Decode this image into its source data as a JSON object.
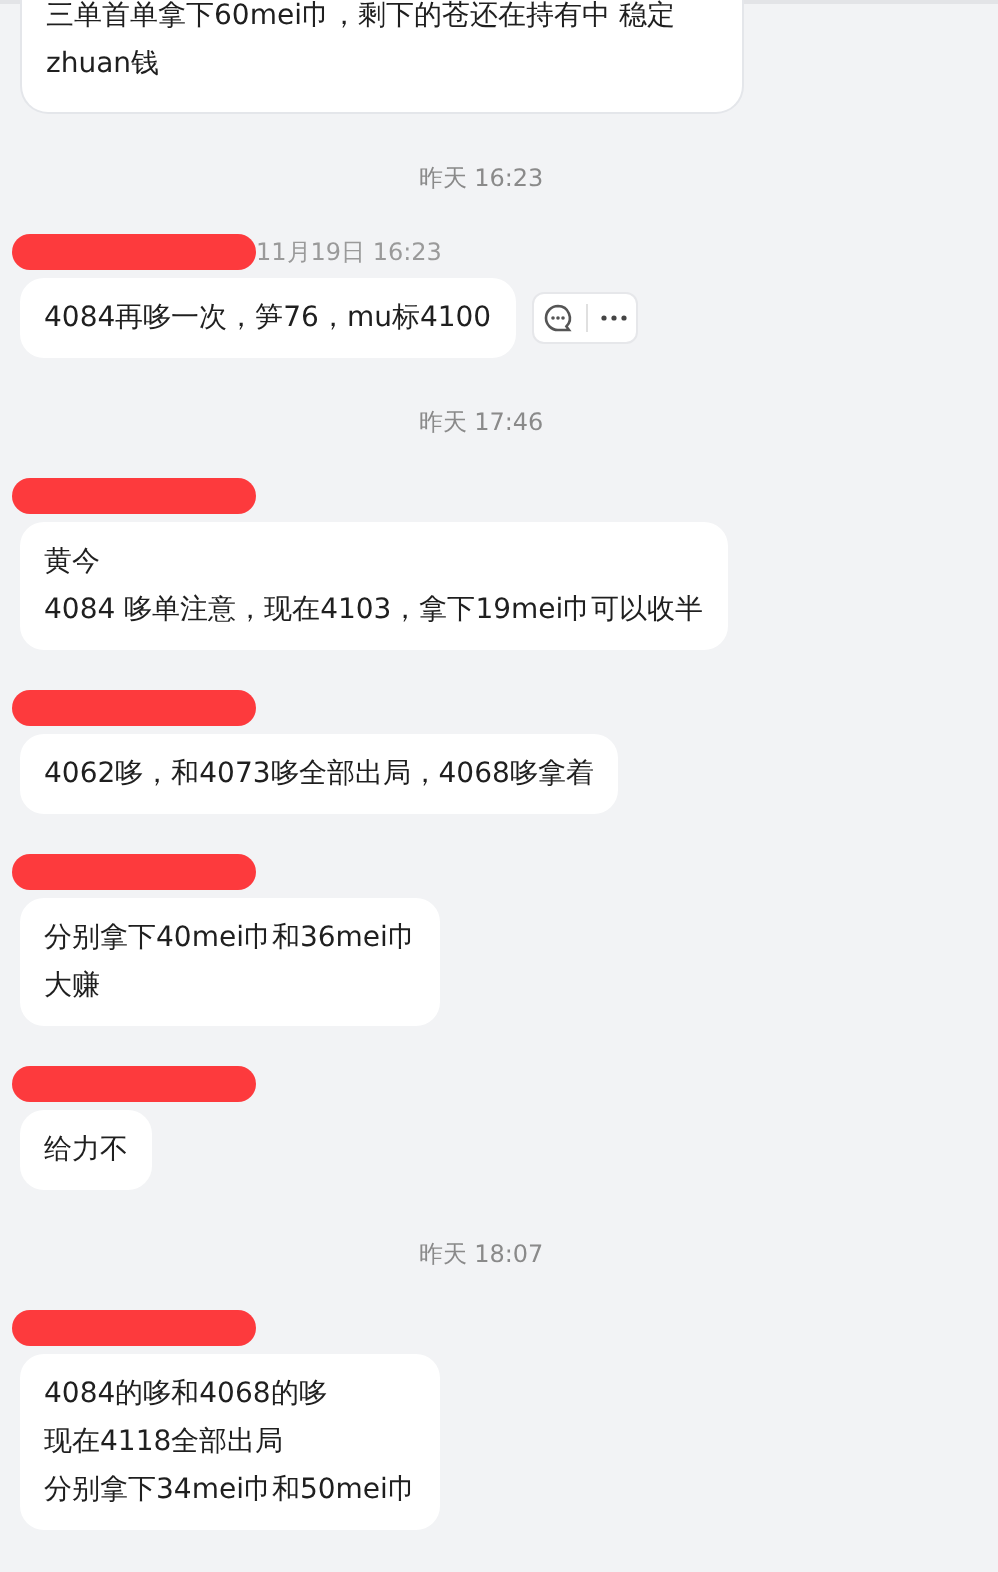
{
  "messages": [
    {
      "kind": "message",
      "lines": [
        "三单首单拿下60mei巾，剩下的苍还在持有中 稳定 zhuan钱"
      ],
      "actions_shown": false
    },
    {
      "kind": "time",
      "text": "昨天 16:23"
    },
    {
      "kind": "message",
      "sent_time": "11月19日 16:23",
      "lines": [
        "4084再哆一次，笋76，mu标4100"
      ],
      "actions_shown": true
    },
    {
      "kind": "time",
      "text": "昨天 17:46"
    },
    {
      "kind": "message",
      "lines": [
        "黄今",
        "4084 哆单注意，现在4103，拿下19mei巾可以收半"
      ],
      "actions_shown": false
    },
    {
      "kind": "message",
      "lines": [
        "4062哆，和4073哆全部出局，4068哆拿着"
      ],
      "actions_shown": false
    },
    {
      "kind": "message",
      "lines": [
        "分别拿下40mei巾和36mei巾",
        "大赚"
      ],
      "actions_shown": false
    },
    {
      "kind": "message",
      "lines": [
        "给力不"
      ],
      "actions_shown": false
    },
    {
      "kind": "time",
      "text": "昨天 18:07"
    },
    {
      "kind": "message",
      "lines": [
        "4084的哆和4068的哆",
        "现在4118全部出局",
        "分别拿下34mei巾和50mei巾"
      ],
      "actions_shown": false
    }
  ]
}
